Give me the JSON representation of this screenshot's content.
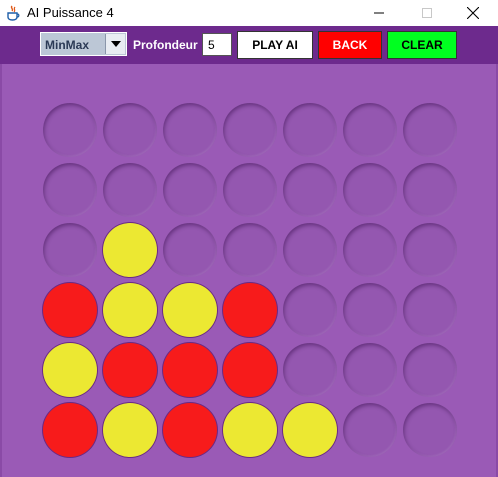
{
  "window": {
    "title": "AI Puissance 4",
    "icons": {
      "app": "java-cup-icon",
      "minimize": "minimize-icon",
      "maximize": "maximize-icon",
      "close": "close-icon"
    }
  },
  "toolbar": {
    "algorithm": {
      "value": "MinMax"
    },
    "depth_label": "Profondeur",
    "depth_value": "5",
    "play_label": "PLAY AI",
    "back_label": "BACK",
    "clear_label": "CLEAR"
  },
  "colors": {
    "toolbar_bg": "#6d2a8d",
    "board_bg": "#9a5ab6",
    "red_disc": "#f71b1b",
    "yellow_disc": "#ece832",
    "back_button": "#ff0000",
    "clear_button": "#00ff20"
  },
  "board": {
    "rows": 6,
    "cols": 7,
    "cells": [
      [
        "empty",
        "empty",
        "empty",
        "empty",
        "empty",
        "empty",
        "empty"
      ],
      [
        "empty",
        "empty",
        "empty",
        "empty",
        "empty",
        "empty",
        "empty"
      ],
      [
        "empty",
        "yellow",
        "empty",
        "empty",
        "empty",
        "empty",
        "empty"
      ],
      [
        "red",
        "yellow",
        "yellow",
        "red",
        "empty",
        "empty",
        "empty"
      ],
      [
        "yellow",
        "red",
        "red",
        "red",
        "empty",
        "empty",
        "empty"
      ],
      [
        "red",
        "yellow",
        "red",
        "yellow",
        "yellow",
        "empty",
        "empty"
      ]
    ]
  }
}
